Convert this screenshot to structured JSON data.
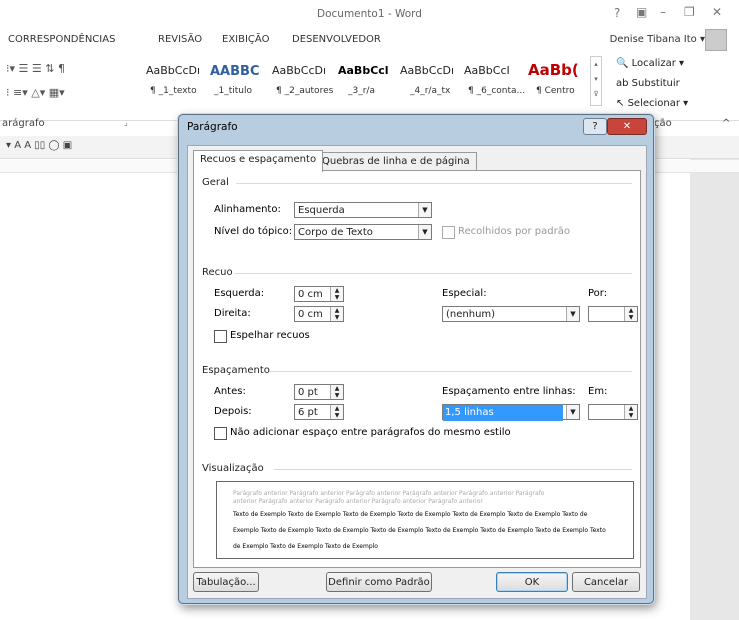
{
  "word": {
    "doc_title": "Documento1 - Word",
    "window_controls": [
      "?",
      "–",
      "✕"
    ],
    "ribbon_tabs": [
      "CORRESPONDÊNCIAS",
      "REVISÃO",
      "EXIBIÇÃO",
      "DESENVOLVEDOR"
    ],
    "user": "Denise Tibana Ito",
    "styles": [
      {
        "sample": "AaBbCcDı",
        "name": "¶ _1_texto"
      },
      {
        "sample": "AABBC",
        "name": "_1_titulo"
      },
      {
        "sample": "AaBbCcDı",
        "name": "¶ _2_autores"
      },
      {
        "sample": "AaBbCcl",
        "name": "_3_r/a"
      },
      {
        "sample": "AaBbCcDı",
        "name": "_4_r/a_tx"
      },
      {
        "sample": "AaBbCcI",
        "name": "¶ _6_conta..."
      },
      {
        "sample": "AaBb(",
        "name": "¶ Centro"
      }
    ],
    "editing": {
      "find": "Localizar",
      "replace": "Substituir",
      "select": "Selecionar"
    },
    "group_label": "arágrafo",
    "group_label_right": "ção"
  },
  "dialog": {
    "title": "Parágrafo",
    "help": "?",
    "close": "✕",
    "tabs": [
      "Recuos e espaçamento",
      "Quebras de linha e de página"
    ],
    "geral": {
      "heading": "Geral",
      "alinhamento_label": "Alinhamento:",
      "alinhamento_value": "Esquerda",
      "nivel_label": "Nível do tópico:",
      "nivel_value": "Corpo de Texto",
      "recolhidos_label": "Recolhidos por padrão"
    },
    "recuo": {
      "heading": "Recuo",
      "esquerda_label": "Esquerda:",
      "esquerda_value": "0 cm",
      "direita_label": "Direita:",
      "direita_value": "0 cm",
      "especial_label": "Especial:",
      "especial_value": "(nenhum)",
      "por_label": "Por:",
      "espelhar_label": "Espelhar recuos"
    },
    "espacamento": {
      "heading": "Espaçamento",
      "antes_label": "Antes:",
      "antes_value": "0 pt",
      "depois_label": "Depois:",
      "depois_value": "6 pt",
      "entre_linhas_label": "Espaçamento entre linhas:",
      "entre_linhas_value": "1,5 linhas",
      "em_label": "Em:",
      "nao_adicionar_label": "Não adicionar espaço entre parágrafos do mesmo estilo"
    },
    "visualizacao": {
      "heading": "Visualização",
      "prev_lines": [
        "Parágrafo anterior Parágrafo anterior Parágrafo anterior Parágrafo anterior Parágrafo anterior Parágrafo",
        "anterior Parágrafo anterior Parágrafo anterior Parágrafo anterior Parágrafo anterior"
      ],
      "sample_lines": [
        "Texto de Exemplo Texto de Exemplo Texto de Exemplo Texto de Exemplo Texto de Exemplo Texto de Exemplo Texto de",
        "Exemplo Texto de Exemplo Texto de Exemplo Texto de Exemplo Texto de Exemplo Texto de Exemplo Texto de Exemplo Texto",
        "de Exemplo Texto de Exemplo Texto de Exemplo"
      ]
    },
    "buttons": {
      "tabulacao": "Tabulação...",
      "padrao": "Definir como Padrão",
      "ok": "OK",
      "cancelar": "Cancelar"
    }
  }
}
